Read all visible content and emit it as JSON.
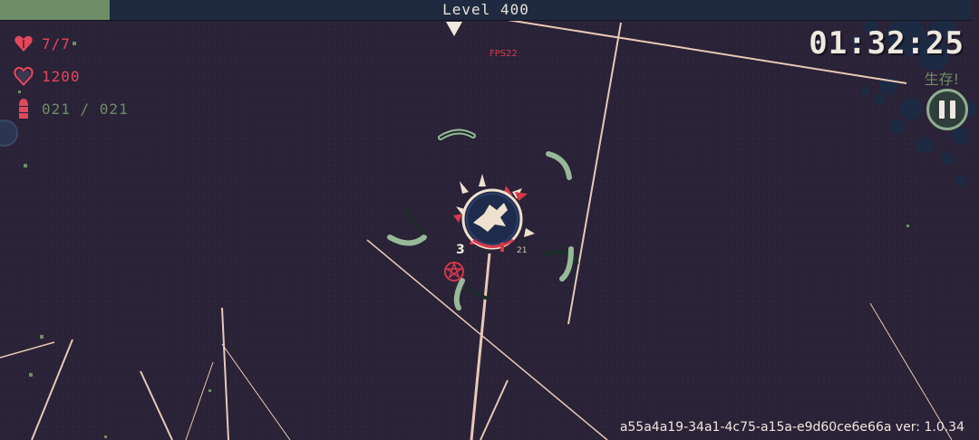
{
  "level_bar": {
    "label": "Level 400",
    "xp_fraction": 0.113
  },
  "stats": {
    "hp": "7/7",
    "shield": "1200",
    "ammo": "021 / 021"
  },
  "fps_label": "FPS22",
  "timer": "01:32:25",
  "survive_label": "生存!",
  "player": {
    "combo_count": "3",
    "small_number": "21"
  },
  "version_text": "a55a4a19-34a1-4c75-a15a-e9d60ce6e66a ver: 1.0.34",
  "colors": {
    "background": "#2a2236",
    "accent_red": "#e2475c",
    "accent_green": "#6d8e67",
    "text_light": "#efe8df"
  },
  "icons": {
    "hp": "heart-icon",
    "shield": "shield-heart-icon",
    "ammo": "bullet-icon",
    "pause": "pause-icon"
  }
}
